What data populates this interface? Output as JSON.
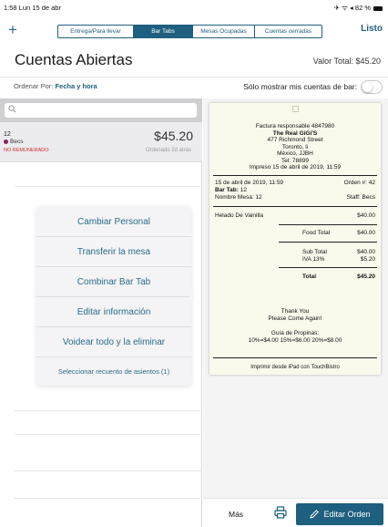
{
  "status_bar": {
    "time": "1:58  Lun 15 de abr",
    "right": "✈ ᯤ ◂ 82 %"
  },
  "nav": {
    "add_icon": "+",
    "segments": [
      "Entrega/Para llevar",
      "Bar Tabs",
      "Mesas Ocupadas",
      "Cuentas cerradas"
    ],
    "active_segment": "Bar Tabs",
    "done_label": "Listo"
  },
  "header": {
    "title": "Cuentas Abiertas",
    "total_label": "Valor Total: $45.20"
  },
  "sort": {
    "label": "Ordenar Por:",
    "value": "Fecha y hora",
    "only_mine_label": "Sólo mostrar mis cuentas de bar:",
    "only_mine_on": false
  },
  "account": {
    "number": "12",
    "staff": "Becs",
    "staff_color": "#8b2358",
    "status": "NO REMUNERADO",
    "status_color": "#d12b2b",
    "amount": "$45.20",
    "ordered": "Ordenado 2d atrás"
  },
  "context_menu": {
    "items": [
      "Cambiar Personal",
      "Transferir la mesa",
      "Combinar Bar Tab",
      "Editar información",
      "Voidear todo y la eliminar",
      "Seleccionar recuento de asientos (1)"
    ]
  },
  "receipt": {
    "header_lines": [
      "Factura responsable 4847980",
      "The Real GiGi'S",
      "477 Richmond Street",
      "Toronto, li",
      "México, JJBH",
      "Tel: 78899",
      "Impreso 15 de abril de 2019, 11:59"
    ],
    "date": "15 de abril de 2019, 11:59",
    "order_no": "Orden #: 42",
    "bar_tab_label": "Bar Tab:",
    "bar_tab_value": "12",
    "table_name": "Nombre Mesa: 12",
    "staff": "Staff: Becs",
    "items": [
      {
        "name": "Helado De Vainilla",
        "price": "$40.00"
      }
    ],
    "food_total_label": "Food Total",
    "food_total": "$40.00",
    "subtotal_label": "Sub Total",
    "subtotal": "$40.00",
    "tax_label": "IVA 13%",
    "tax": "$5.20",
    "total_label": "Total",
    "total": "$45.20",
    "thanks": [
      "Thank You",
      "Please Come Again!"
    ],
    "tip_title": "Guía de Propinas:",
    "tip_line": "10%=$4.00   15%=$6.00   20%=$8.00",
    "printed_from": "Imprimir desde iPad con TouchBistro"
  },
  "bottom": {
    "more_label": "Más",
    "edit_label": "Editar Orden",
    "accent": "#1f5f7f"
  }
}
